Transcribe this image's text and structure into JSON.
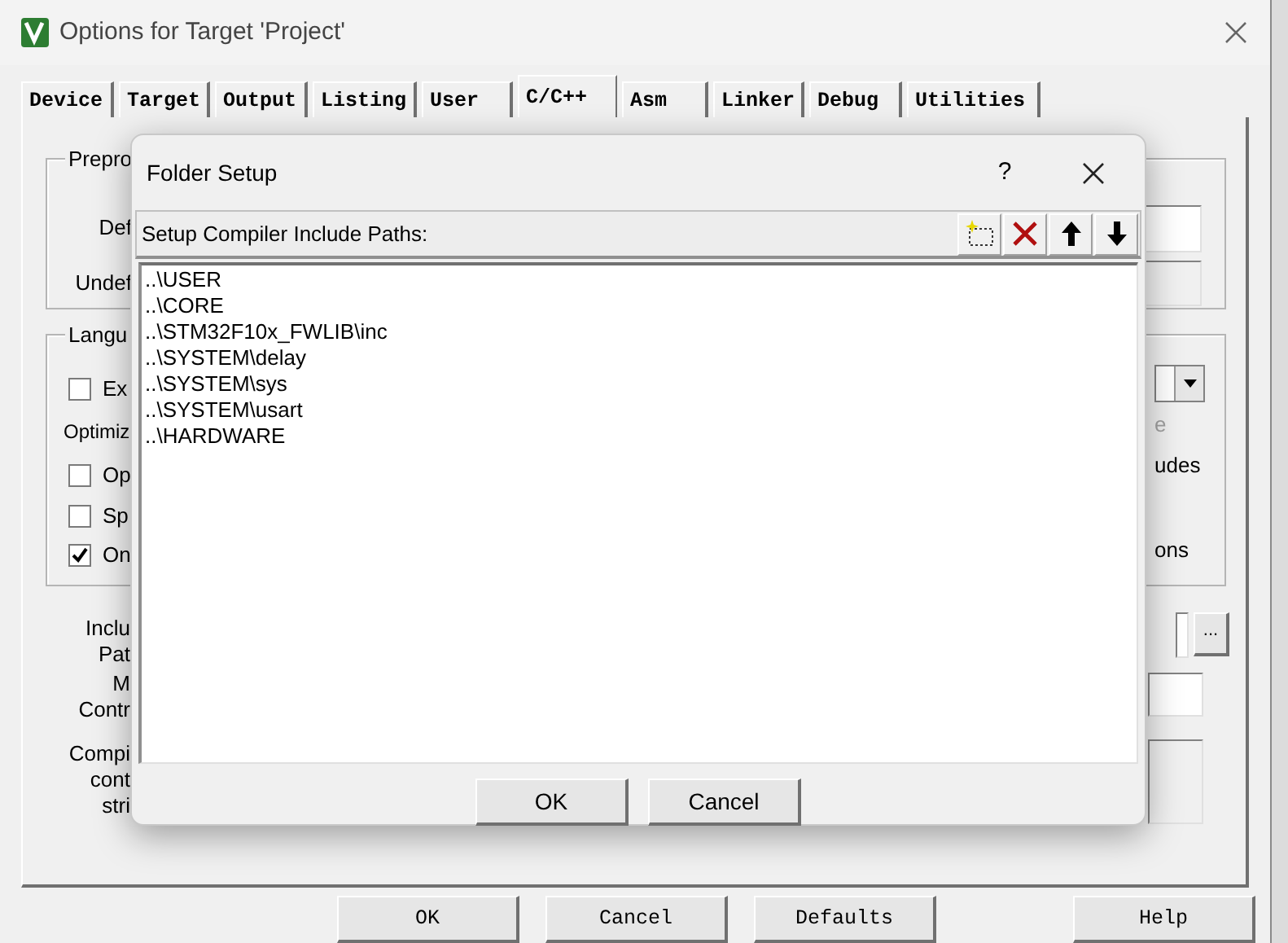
{
  "window": {
    "title": "Options for Target 'Project'"
  },
  "tabs": [
    {
      "label": "Device",
      "selected": false
    },
    {
      "label": "Target",
      "selected": false
    },
    {
      "label": "Output",
      "selected": false
    },
    {
      "label": "Listing",
      "selected": false
    },
    {
      "label": "User",
      "selected": false
    },
    {
      "label": "C/C++",
      "selected": true
    },
    {
      "label": "Asm",
      "selected": false
    },
    {
      "label": "Linker",
      "selected": false
    },
    {
      "label": "Debug",
      "selected": false
    },
    {
      "label": "Utilities",
      "selected": false
    }
  ],
  "preprocessor": {
    "legend": "Prepro",
    "define_label": "Def",
    "undefine_label": "Undef"
  },
  "language": {
    "legend": "Langu",
    "top_checkbox": {
      "label": "Ex",
      "checked": false
    },
    "optimization_label": "Optimiz",
    "checkboxes": [
      {
        "label": "Op",
        "checked": false
      },
      {
        "label": "Sp",
        "checked": false
      },
      {
        "label": "On",
        "checked": true
      }
    ],
    "right_texts": [
      {
        "text": "e",
        "disabled": true
      },
      {
        "text": "udes",
        "disabled": false
      },
      {
        "text": "ons",
        "disabled": false
      }
    ]
  },
  "include_paths_label": [
    "Inclu",
    "Pat"
  ],
  "browse_button": "...",
  "misc_controls_label": [
    "M",
    "Contr"
  ],
  "compiler_string_label": [
    "Compi",
    "cont",
    "stri"
  ],
  "buttons": [
    "OK",
    "Cancel",
    "Defaults",
    "Help"
  ],
  "folder_setup": {
    "title": "Folder Setup",
    "help": "?",
    "list_label": "Setup Compiler Include Paths:",
    "paths": [
      "..\\USER",
      "..\\CORE",
      "..\\STM32F10x_FWLIB\\inc",
      "..\\SYSTEM\\delay",
      "..\\SYSTEM\\sys",
      "..\\SYSTEM\\usart",
      "..\\HARDWARE"
    ],
    "buttons": [
      "OK",
      "Cancel"
    ]
  }
}
